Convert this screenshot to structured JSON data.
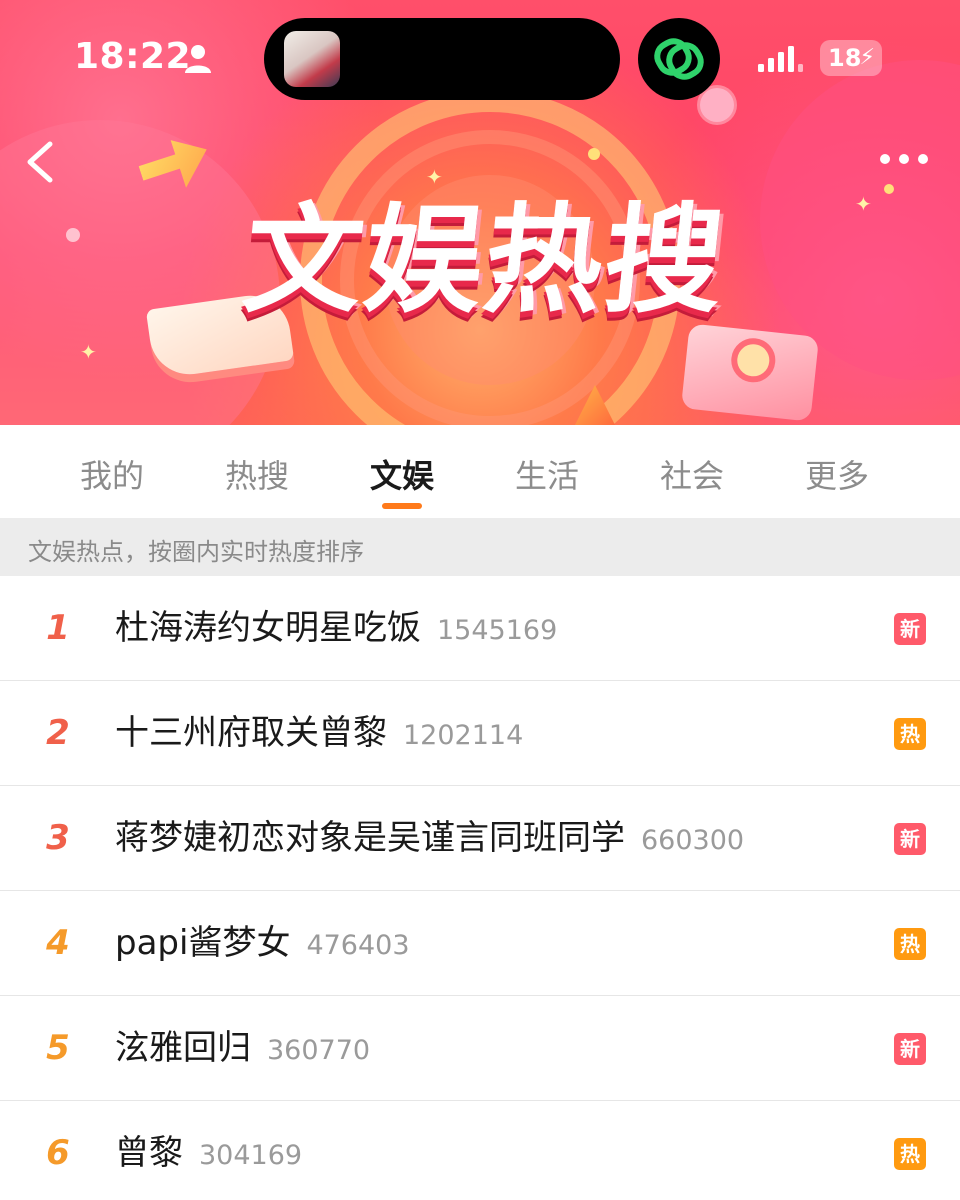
{
  "status_bar": {
    "time": "18:22",
    "battery": "18"
  },
  "banner": {
    "title": "文娱热搜"
  },
  "tabs": [
    {
      "label": "我的",
      "active": false
    },
    {
      "label": "热搜",
      "active": false
    },
    {
      "label": "文娱",
      "active": true
    },
    {
      "label": "生活",
      "active": false
    },
    {
      "label": "社会",
      "active": false
    },
    {
      "label": "更多",
      "active": false
    }
  ],
  "subtitle": "文娱热点，按圈内实时热度排序",
  "list": [
    {
      "rank": "1",
      "title": "杜海涛约女明星吃饭",
      "count": "1545169",
      "badge": "新",
      "badge_type": "new"
    },
    {
      "rank": "2",
      "title": "十三州府取关曾黎",
      "count": "1202114",
      "badge": "热",
      "badge_type": "hot"
    },
    {
      "rank": "3",
      "title": "蒋梦婕初恋对象是吴谨言同班同学",
      "count": "660300",
      "badge": "新",
      "badge_type": "new"
    },
    {
      "rank": "4",
      "title": "papi酱梦女",
      "count": "476403",
      "badge": "热",
      "badge_type": "hot"
    },
    {
      "rank": "5",
      "title": "泫雅回归",
      "count": "360770",
      "badge": "新",
      "badge_type": "new"
    },
    {
      "rank": "6",
      "title": "曾黎",
      "count": "304169",
      "badge": "热",
      "badge_type": "hot"
    }
  ],
  "colors": {
    "accent": "#ff7a1a",
    "rank_top": "#f0604a",
    "rank_other": "#f59a2a",
    "badge_new": "#ff5a6a",
    "badge_hot": "#ff9a10"
  },
  "icons": {
    "person": "person-icon",
    "island_avatar": "avatar",
    "link": "link-icon",
    "signal": "signal-icon",
    "battery": "battery-icon",
    "back": "back-arrow-icon",
    "more": "more-dots-icon"
  }
}
